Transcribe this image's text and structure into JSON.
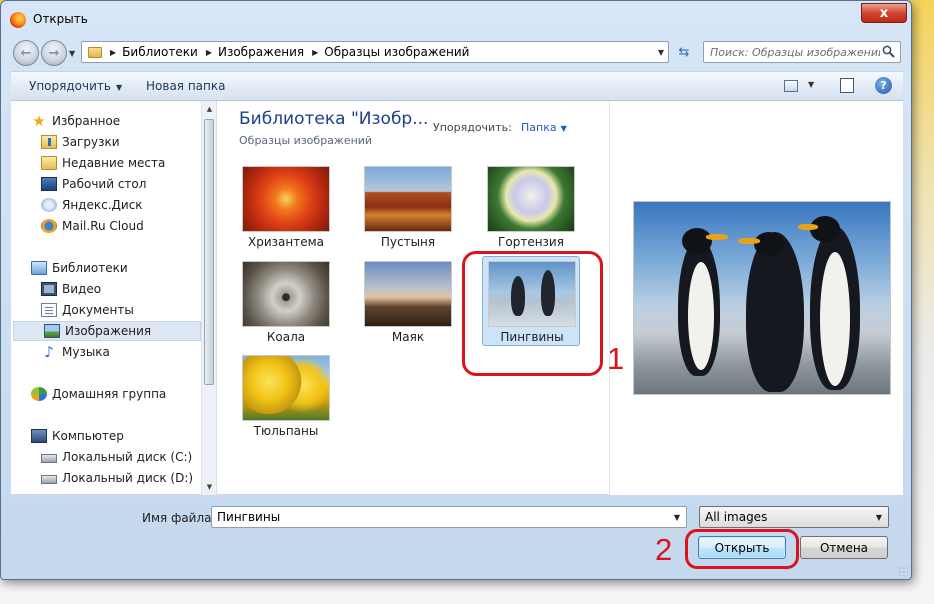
{
  "window": {
    "title": "Открыть",
    "close_glyph": "x"
  },
  "address": {
    "back_glyph": "←",
    "forward_glyph": "→",
    "crumbs": [
      "Библиотеки",
      "Изображения",
      "Образцы изображений"
    ],
    "search_placeholder": "Поиск: Образцы изображений"
  },
  "toolbar": {
    "organize_label": "Упорядочить",
    "new_folder_label": "Новая папка",
    "help_glyph": "?"
  },
  "nav": {
    "favorites": "Избранное",
    "downloads": "Загрузки",
    "recent": "Недавние места",
    "desktop": "Рабочий стол",
    "yandex": "Яндекс.Диск",
    "mailru": "Mail.Ru Cloud",
    "libraries": "Библиотеки",
    "video": "Видео",
    "documents": "Документы",
    "images": "Изображения",
    "music": "Музыка",
    "homegroup": "Домашняя группа",
    "computer": "Компьютер",
    "disk_c": "Локальный диск (C:)",
    "disk_d": "Локальный диск (D:)"
  },
  "library": {
    "title": "Библиотека \"Изобр...",
    "subtitle": "Образцы изображений",
    "arrange_label": "Упорядочить:",
    "arrange_value": "Папка"
  },
  "files": [
    {
      "name": "Хризантема"
    },
    {
      "name": "Пустыня"
    },
    {
      "name": "Гортензия"
    },
    {
      "name": "Коала"
    },
    {
      "name": "Маяк"
    },
    {
      "name": "Пингвины"
    },
    {
      "name": "Тюльпаны"
    }
  ],
  "selected_file": "Пингвины",
  "footer": {
    "filename_label": "Имя файла:",
    "filename_value": "Пингвины",
    "filetype_value": "All images",
    "open_label": "Открыть",
    "cancel_label": "Отмена"
  },
  "annotations": {
    "step1": "1",
    "step2": "2",
    "color": "#d9141c"
  },
  "icons": [
    "app-icon",
    "back-icon",
    "forward-icon",
    "folder-icon",
    "refresh-icon",
    "search-icon",
    "views-icon",
    "preview-pane-icon",
    "help-icon",
    "star-icon",
    "drive-icon"
  ]
}
